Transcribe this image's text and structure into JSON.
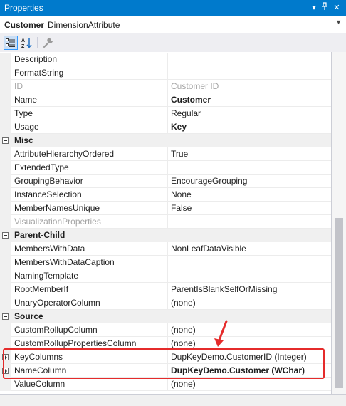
{
  "panel": {
    "title": "Properties"
  },
  "object": {
    "name": "Customer",
    "type": "DimensionAttribute"
  },
  "colors": {
    "accent": "#007acc",
    "highlight": "#e52b2b"
  },
  "icons": [
    "categorized-icon",
    "alphabetical-icon",
    "property-pages-icon",
    "pin-icon",
    "close-icon",
    "dropdown-icon"
  ],
  "grid": {
    "rows": [
      {
        "kind": "prop",
        "name": "Description",
        "value": ""
      },
      {
        "kind": "prop",
        "name": "FormatString",
        "value": ""
      },
      {
        "kind": "prop",
        "name": "ID",
        "value": "Customer ID",
        "readonly": true
      },
      {
        "kind": "prop",
        "name": "Name",
        "value": "Customer",
        "bold": true
      },
      {
        "kind": "prop",
        "name": "Type",
        "value": "Regular"
      },
      {
        "kind": "prop",
        "name": "Usage",
        "value": "Key",
        "bold": true
      },
      {
        "kind": "cat",
        "name": "Misc"
      },
      {
        "kind": "prop",
        "name": "AttributeHierarchyOrdered",
        "value": "True"
      },
      {
        "kind": "prop",
        "name": "ExtendedType",
        "value": ""
      },
      {
        "kind": "prop",
        "name": "GroupingBehavior",
        "value": "EncourageGrouping"
      },
      {
        "kind": "prop",
        "name": "InstanceSelection",
        "value": "None"
      },
      {
        "kind": "prop",
        "name": "MemberNamesUnique",
        "value": "False"
      },
      {
        "kind": "prop",
        "name": "VisualizationProperties",
        "value": "",
        "readonly": true
      },
      {
        "kind": "cat",
        "name": "Parent-Child"
      },
      {
        "kind": "prop",
        "name": "MembersWithData",
        "value": "NonLeafDataVisible"
      },
      {
        "kind": "prop",
        "name": "MembersWithDataCaption",
        "value": ""
      },
      {
        "kind": "prop",
        "name": "NamingTemplate",
        "value": ""
      },
      {
        "kind": "prop",
        "name": "RootMemberIf",
        "value": "ParentIsBlankSelfOrMissing"
      },
      {
        "kind": "prop",
        "name": "UnaryOperatorColumn",
        "value": "(none)"
      },
      {
        "kind": "cat",
        "name": "Source"
      },
      {
        "kind": "prop",
        "name": "CustomRollupColumn",
        "value": "(none)"
      },
      {
        "kind": "prop",
        "name": "CustomRollupPropertiesColumn",
        "value": "(none)"
      },
      {
        "kind": "prop",
        "name": "KeyColumns",
        "value": "DupKeyDemo.CustomerID (Integer)",
        "expandable": true
      },
      {
        "kind": "prop",
        "name": "NameColumn",
        "value": "DupKeyDemo.Customer (WChar)",
        "expandable": true,
        "bold": true
      },
      {
        "kind": "prop",
        "name": "ValueColumn",
        "value": "(none)"
      }
    ]
  }
}
